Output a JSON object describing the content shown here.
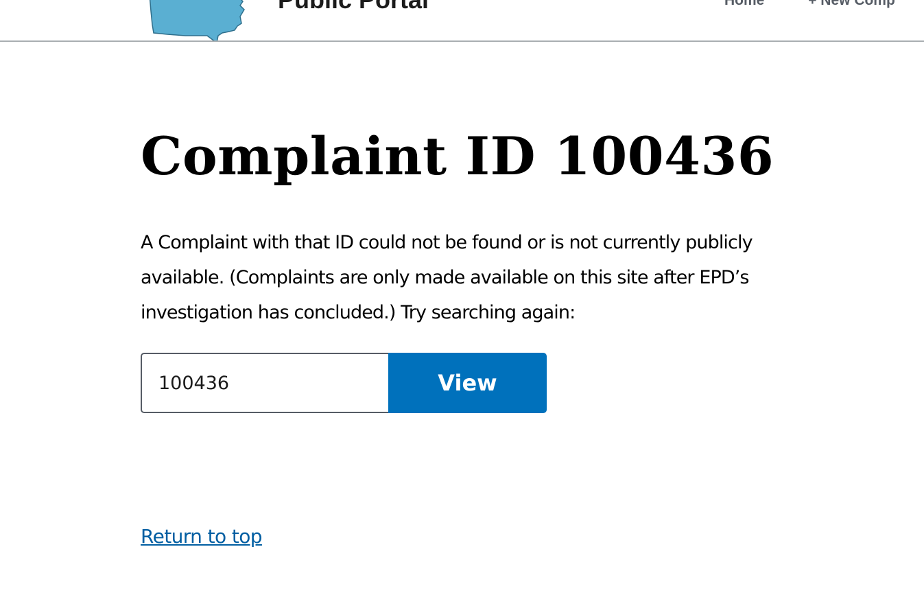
{
  "header": {
    "site_title": "Public Portal",
    "logo_icon": "georgia-state-map-icon",
    "logo_color": "#5aafd2",
    "nav": {
      "home_label": "Home",
      "new_complaint_label": "+ New Comp"
    }
  },
  "main": {
    "title": "Complaint ID 100436",
    "message": "A Complaint with that ID could not be found or is not currently publicly available. (Complaints are only made available on this site after EPD’s investigation has concluded.) Try searching again:",
    "search": {
      "value": "100436",
      "button_label": "View"
    }
  },
  "footer": {
    "return_to_top": "Return to top"
  },
  "colors": {
    "accent": "#0071bc",
    "link": "#005ea2",
    "nav_text": "#565c65",
    "header_border": "#a9aeb1"
  }
}
